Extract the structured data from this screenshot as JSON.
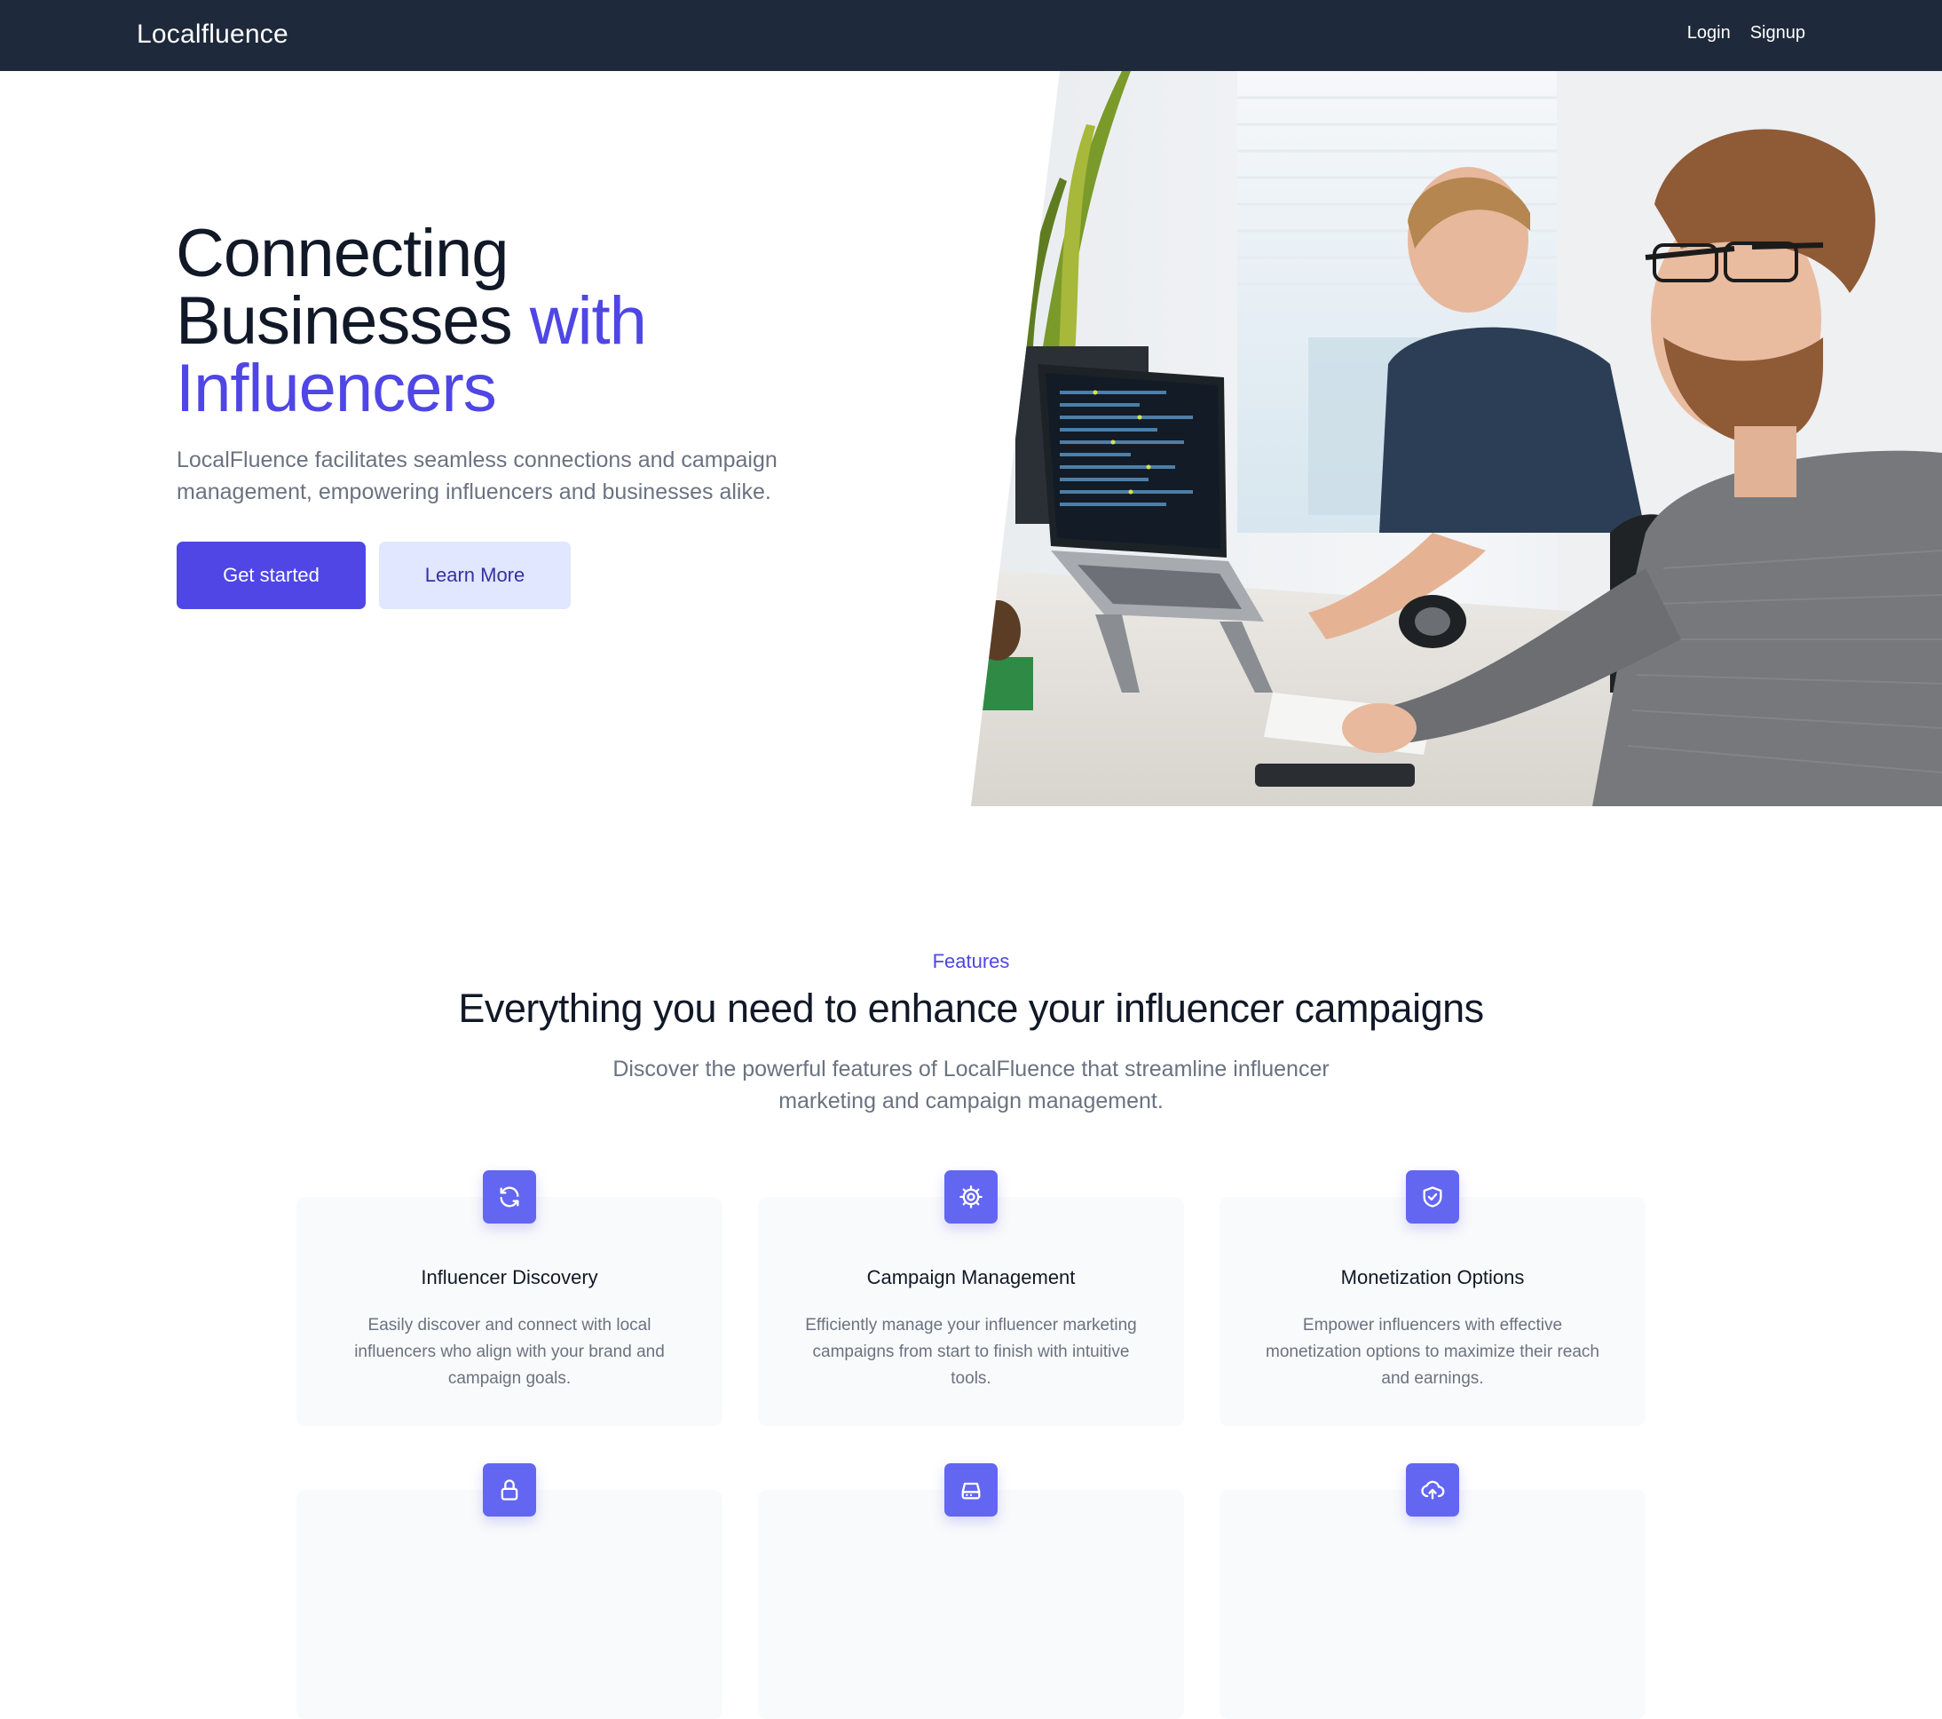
{
  "nav": {
    "brand": "Localfluence",
    "links": [
      "Login",
      "Signup"
    ]
  },
  "hero": {
    "title_line1": "Connecting",
    "title_line2_plain": "Businesses",
    "title_line2_accent": "with",
    "title_line3_accent": "Influencers",
    "subtitle": "LocalFluence facilitates seamless connections and campaign management, empowering influencers and businesses alike.",
    "primary_button": "Get started",
    "secondary_button": "Learn More",
    "image_description": "two-men-working-at-laptops"
  },
  "features": {
    "eyebrow": "Features",
    "title": "Everything you need to enhance your influencer campaigns",
    "subtitle": "Discover the powerful features of LocalFluence that streamline influencer marketing and campaign management.",
    "items": [
      {
        "icon": "refresh-icon",
        "title": "Influencer Discovery",
        "description": "Easily discover and connect with local influencers who align with your brand and campaign goals."
      },
      {
        "icon": "gear-icon",
        "title": "Campaign Management",
        "description": "Efficiently manage your influencer marketing campaigns from start to finish with intuitive tools."
      },
      {
        "icon": "shield-check-icon",
        "title": "Monetization Options",
        "description": "Empower influencers with effective monetization options to maximize their reach and earnings."
      },
      {
        "icon": "lock-icon",
        "title": "",
        "description": ""
      },
      {
        "icon": "server-icon",
        "title": "",
        "description": ""
      },
      {
        "icon": "cloud-upload-icon",
        "title": "",
        "description": ""
      }
    ]
  },
  "colors": {
    "nav_bg": "#1e293b",
    "accent": "#4f46e5",
    "icon_bg": "#6366f1",
    "secondary_btn_bg": "#e0e7ff",
    "card_bg": "#f9fafb"
  }
}
